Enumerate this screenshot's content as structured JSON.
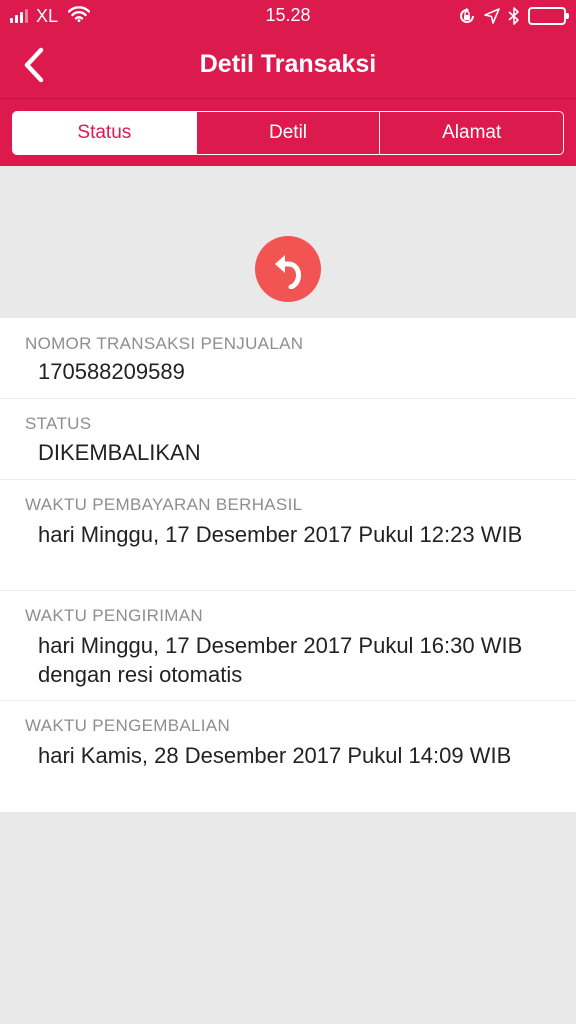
{
  "status_bar": {
    "carrier": "XL",
    "time": "15.28",
    "icons": [
      "signal-icon",
      "wifi-icon",
      "orientation-lock-icon",
      "location-arrow-icon",
      "bluetooth-icon",
      "battery-icon"
    ]
  },
  "header": {
    "title": "Detil Transaksi",
    "back_icon": "chevron-left-icon",
    "color": "#dc1a4e"
  },
  "tabs": [
    {
      "label": "Status",
      "active": true
    },
    {
      "label": "Detil",
      "active": false
    },
    {
      "label": "Alamat",
      "active": false
    }
  ],
  "status_icon": {
    "name": "return-arrow-icon",
    "color": "#f25454"
  },
  "details": [
    {
      "label": "NOMOR TRANSAKSI PENJUALAN",
      "value": "170588209589"
    },
    {
      "label": "STATUS",
      "value": "DIKEMBALIKAN"
    },
    {
      "label": "WAKTU PEMBAYARAN BERHASIL",
      "value": "hari Minggu, 17 Desember 2017 Pukul 12:23 WIB"
    },
    {
      "label": "WAKTU PENGIRIMAN",
      "value": "hari Minggu, 17 Desember 2017 Pukul 16:30 WIB dengan resi otomatis"
    },
    {
      "label": "WAKTU PENGEMBALIAN",
      "value": "hari Kamis, 28 Desember 2017 Pukul 14:09 WIB"
    }
  ]
}
